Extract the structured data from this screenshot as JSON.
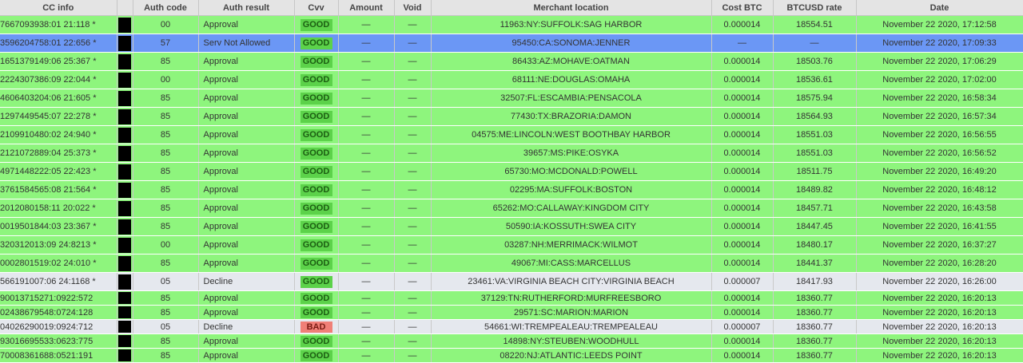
{
  "columns": [
    "CC info",
    "",
    "Auth code",
    "Auth result",
    "Cvv",
    "Amount",
    "Void",
    "Merchant location",
    "Cost BTC",
    "BTCUSD rate",
    "Date"
  ],
  "rows": [
    {
      "cc": "7667093938:01 21:118 *",
      "auth_code": "00",
      "auth_result": "Approval",
      "cvv": "GOOD",
      "amount": "—",
      "void": "—",
      "location": "11963:NY:SUFFOLK:SAG HARBOR",
      "cost": "0.000014",
      "rate": "18554.51",
      "date": "November 22 2020, 17:12:58",
      "kind": "approval"
    },
    {
      "cc": "3596204758:01 22:656 *",
      "auth_code": "57",
      "auth_result": "Serv Not Allowed",
      "cvv": "GOOD",
      "amount": "—",
      "void": "—",
      "location": "95450:CA:SONOMA:JENNER",
      "cost": "—",
      "rate": "—",
      "date": "November 22 2020, 17:09:33",
      "kind": "selected"
    },
    {
      "cc": "1651379149:06 25:367 *",
      "auth_code": "85",
      "auth_result": "Approval",
      "cvv": "GOOD",
      "amount": "—",
      "void": "—",
      "location": "86433:AZ:MOHAVE:OATMAN",
      "cost": "0.000014",
      "rate": "18503.76",
      "date": "November 22 2020, 17:06:29",
      "kind": "approval"
    },
    {
      "cc": "2224307386:09 22:044 *",
      "auth_code": "00",
      "auth_result": "Approval",
      "cvv": "GOOD",
      "amount": "—",
      "void": "—",
      "location": "68111:NE:DOUGLAS:OMAHA",
      "cost": "0.000014",
      "rate": "18536.61",
      "date": "November 22 2020, 17:02:00",
      "kind": "approval"
    },
    {
      "cc": "4606403204:06 21:605 *",
      "auth_code": "85",
      "auth_result": "Approval",
      "cvv": "GOOD",
      "amount": "—",
      "void": "—",
      "location": "32507:FL:ESCAMBIA:PENSACOLA",
      "cost": "0.000014",
      "rate": "18575.94",
      "date": "November 22 2020, 16:58:34",
      "kind": "approval"
    },
    {
      "cc": "1297449545:07 22:278 *",
      "auth_code": "85",
      "auth_result": "Approval",
      "cvv": "GOOD",
      "amount": "—",
      "void": "—",
      "location": "77430:TX:BRAZORIA:DAMON",
      "cost": "0.000014",
      "rate": "18564.93",
      "date": "November 22 2020, 16:57:34",
      "kind": "approval"
    },
    {
      "cc": "2109910480:02 24:940 *",
      "auth_code": "85",
      "auth_result": "Approval",
      "cvv": "GOOD",
      "amount": "—",
      "void": "—",
      "location": "04575:ME:LINCOLN:WEST BOOTHBAY HARBOR",
      "cost": "0.000014",
      "rate": "18551.03",
      "date": "November 22 2020, 16:56:55",
      "kind": "approval"
    },
    {
      "cc": "2121072889:04 25:373 *",
      "auth_code": "85",
      "auth_result": "Approval",
      "cvv": "GOOD",
      "amount": "—",
      "void": "—",
      "location": "39657:MS:PIKE:OSYKA",
      "cost": "0.000014",
      "rate": "18551.03",
      "date": "November 22 2020, 16:56:52",
      "kind": "approval"
    },
    {
      "cc": "4971448222:05 22:423 *",
      "auth_code": "85",
      "auth_result": "Approval",
      "cvv": "GOOD",
      "amount": "—",
      "void": "—",
      "location": "65730:MO:MCDONALD:POWELL",
      "cost": "0.000014",
      "rate": "18511.75",
      "date": "November 22 2020, 16:49:20",
      "kind": "approval"
    },
    {
      "cc": "3761584565:08 21:564 *",
      "auth_code": "85",
      "auth_result": "Approval",
      "cvv": "GOOD",
      "amount": "—",
      "void": "—",
      "location": "02295:MA:SUFFOLK:BOSTON",
      "cost": "0.000014",
      "rate": "18489.82",
      "date": "November 22 2020, 16:48:12",
      "kind": "approval"
    },
    {
      "cc": "2012080158:11 20:022 *",
      "auth_code": "85",
      "auth_result": "Approval",
      "cvv": "GOOD",
      "amount": "—",
      "void": "—",
      "location": "65262:MO:CALLAWAY:KINGDOM CITY",
      "cost": "0.000014",
      "rate": "18457.71",
      "date": "November 22 2020, 16:43:58",
      "kind": "approval"
    },
    {
      "cc": "0019501844:03 23:367 *",
      "auth_code": "85",
      "auth_result": "Approval",
      "cvv": "GOOD",
      "amount": "—",
      "void": "—",
      "location": "50590:IA:KOSSUTH:SWEA CITY",
      "cost": "0.000014",
      "rate": "18447.45",
      "date": "November 22 2020, 16:41:55",
      "kind": "approval"
    },
    {
      "cc": "320312013:09 24:8213 *",
      "auth_code": "00",
      "auth_result": "Approval",
      "cvv": "GOOD",
      "amount": "—",
      "void": "—",
      "location": "03287:NH:MERRIMACK:WILMOT",
      "cost": "0.000014",
      "rate": "18480.17",
      "date": "November 22 2020, 16:37:27",
      "kind": "approval"
    },
    {
      "cc": "0002801519:02 24:010 *",
      "auth_code": "85",
      "auth_result": "Approval",
      "cvv": "GOOD",
      "amount": "—",
      "void": "—",
      "location": "49067:MI:CASS:MARCELLUS",
      "cost": "0.000014",
      "rate": "18441.37",
      "date": "November 22 2020, 16:28:20",
      "kind": "approval"
    },
    {
      "cc": "566191007:06 24:1168 *",
      "auth_code": "05",
      "auth_result": "Decline",
      "cvv": "GOOD",
      "amount": "—",
      "void": "—",
      "location": "23461:VA:VIRGINIA BEACH CITY:VIRGINIA BEACH",
      "cost": "0.000007",
      "rate": "18417.93",
      "date": "November 22 2020, 16:26:00",
      "kind": "decline"
    },
    {
      "cc": "90013715271:0922:572",
      "auth_code": "85",
      "auth_result": "Approval",
      "cvv": "GOOD",
      "amount": "—",
      "void": "—",
      "location": "37129:TN:RUTHERFORD:MURFREESBORO",
      "cost": "0.000014",
      "rate": "18360.77",
      "date": "November 22 2020, 16:20:13",
      "kind": "approval",
      "short": true
    },
    {
      "cc": "02438679548:0724:128",
      "auth_code": "85",
      "auth_result": "Approval",
      "cvv": "GOOD",
      "amount": "—",
      "void": "—",
      "location": "29571:SC:MARION:MARION",
      "cost": "0.000014",
      "rate": "18360.77",
      "date": "November 22 2020, 16:20:13",
      "kind": "approval",
      "short": true
    },
    {
      "cc": "04026290019:0924:712",
      "auth_code": "05",
      "auth_result": "Decline",
      "cvv": "BAD",
      "amount": "—",
      "void": "—",
      "location": "54661:WI:TREMPEALEAU:TREMPEALEAU",
      "cost": "0.000007",
      "rate": "18360.77",
      "date": "November 22 2020, 16:20:13",
      "kind": "decline",
      "short": true
    },
    {
      "cc": "93016695533:0623:775",
      "auth_code": "85",
      "auth_result": "Approval",
      "cvv": "GOOD",
      "amount": "—",
      "void": "—",
      "location": "14898:NY:STEUBEN:WOODHULL",
      "cost": "0.000014",
      "rate": "18360.77",
      "date": "November 22 2020, 16:20:13",
      "kind": "approval",
      "short": true
    },
    {
      "cc": "70008361688:0521:191",
      "auth_code": "85",
      "auth_result": "Approval",
      "cvv": "GOOD",
      "amount": "—",
      "void": "—",
      "location": "08220:NJ:ATLANTIC:LEEDS POINT",
      "cost": "0.000014",
      "rate": "18360.77",
      "date": "November 22 2020, 16:20:13",
      "kind": "approval",
      "short": true
    }
  ],
  "colors": {
    "approval": "#8ef57d",
    "decline": "#e5e8ee",
    "selected": "#6b97f5",
    "cvv_good": "#5cd24a",
    "cvv_bad": "#f07f77",
    "header": "#e4e4e4"
  }
}
